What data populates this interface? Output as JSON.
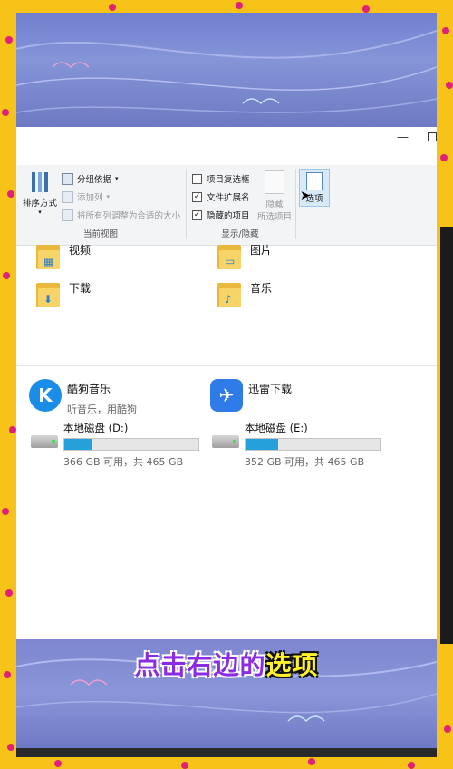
{
  "window": {
    "minimize_glyph": "—",
    "maximize_glyph": ""
  },
  "ribbon": {
    "sort_label": "排序方式",
    "group_by": "分组依据",
    "add_column": "添加列",
    "size_all_columns": "将所有列调整为合适的大小",
    "current_view_label": "当前视图",
    "item_checkboxes": "项目复选框",
    "item_checkboxes_checked": false,
    "file_extensions": "文件扩展名",
    "file_extensions_checked": true,
    "hidden_items": "隐藏的项目",
    "hidden_items_checked": true,
    "hide_label": "隐藏",
    "hide_selected_sub": "所选项目",
    "show_hide_label": "显示/隐藏",
    "options_label": "选项"
  },
  "folders": [
    {
      "name": "视频",
      "icon": "video-folder-icon"
    },
    {
      "name": "图片",
      "icon": "pictures-folder-icon"
    },
    {
      "name": "下载",
      "icon": "downloads-folder-icon"
    },
    {
      "name": "音乐",
      "icon": "music-folder-icon"
    }
  ],
  "apps": [
    {
      "name": "酷狗音乐",
      "sub": "听音乐，用酷狗",
      "icon": "kugou-icon",
      "letter": "K",
      "color": "#1a8ee6"
    },
    {
      "name": "迅雷下载",
      "sub": "",
      "icon": "xunlei-icon",
      "letter": "✈",
      "color": "#2f7ce8"
    }
  ],
  "drives": [
    {
      "name": "本地磁盘 (D:)",
      "free": "366 GB 可用，共 465 GB",
      "used_fraction": 0.21
    },
    {
      "name": "本地磁盘 (E:)",
      "free": "352 GB 可用，共 465 GB",
      "used_fraction": 0.24
    }
  ],
  "subtitle": {
    "part1": "点击右边的",
    "part2": "选项"
  },
  "colors": {
    "accent": "#26a0da",
    "frame": "#f7c319",
    "dots": "#e0217c",
    "subtitle_purple": "#8b2be2",
    "subtitle_yellow": "#fff12a"
  }
}
